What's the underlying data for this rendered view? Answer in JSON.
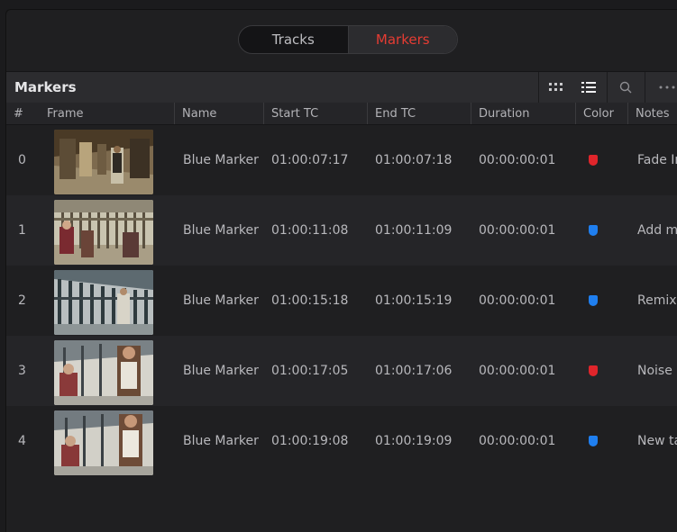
{
  "tabs": [
    {
      "label": "Tracks",
      "active": false
    },
    {
      "label": "Markers",
      "active": true
    }
  ],
  "header": {
    "title": "Markers",
    "buttons": [
      "grid-view-icon",
      "list-view-icon",
      "search-icon",
      "more-icon"
    ]
  },
  "columns": [
    "#",
    "Frame",
    "Name",
    "Start TC",
    "End TC",
    "Duration",
    "Color",
    "Notes"
  ],
  "colors": {
    "red": "#e0252b",
    "blue": "#1f7ff0",
    "accent": "#e53c33"
  },
  "rows": [
    {
      "index": "0",
      "name": "Blue Marker",
      "start": "01:00:07:17",
      "end": "01:00:07:18",
      "duration": "00:00:00:01",
      "color": "red",
      "notes": "Fade In"
    },
    {
      "index": "1",
      "name": "Blue Marker",
      "start": "01:00:11:08",
      "end": "01:00:11:09",
      "duration": "00:00:00:01",
      "color": "blue",
      "notes": "Add m"
    },
    {
      "index": "2",
      "name": "Blue Marker",
      "start": "01:00:15:18",
      "end": "01:00:15:19",
      "duration": "00:00:00:01",
      "color": "blue",
      "notes": "Remix"
    },
    {
      "index": "3",
      "name": "Blue Marker",
      "start": "01:00:17:05",
      "end": "01:00:17:06",
      "duration": "00:00:00:01",
      "color": "red",
      "notes": "Noise r"
    },
    {
      "index": "4",
      "name": "Blue Marker",
      "start": "01:00:19:08",
      "end": "01:00:19:09",
      "duration": "00:00:00:01",
      "color": "blue",
      "notes": "New ta"
    }
  ]
}
